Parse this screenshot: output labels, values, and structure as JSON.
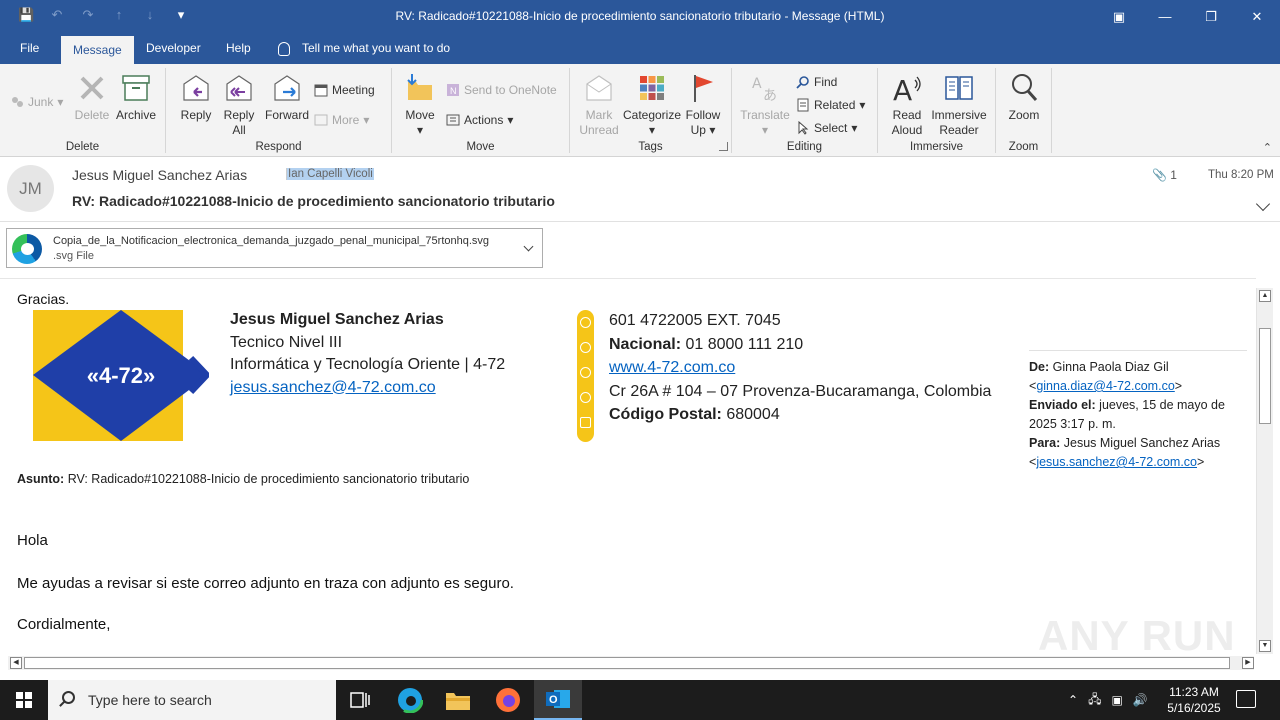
{
  "window": {
    "title": "RV: Radicado#10221088-Inicio de procedimiento sancionatorio tributario  -  Message (HTML)"
  },
  "ribbon": {
    "tabs": [
      {
        "label": "File",
        "active": false
      },
      {
        "label": "Message",
        "active": true
      },
      {
        "label": "Developer",
        "active": false
      },
      {
        "label": "Help",
        "active": false
      }
    ],
    "tell_me": "Tell me what you want to do",
    "groups": {
      "delete": {
        "label": "Delete",
        "junk": "Junk",
        "delete_btn": "Delete",
        "archive": "Archive"
      },
      "respond": {
        "label": "Respond",
        "reply": "Reply",
        "reply_all_1": "Reply",
        "reply_all_2": "All",
        "forward": "Forward",
        "meeting": "Meeting",
        "more": "More"
      },
      "move": {
        "label": "Move",
        "move_btn": "Move",
        "onenote": "Send to OneNote",
        "actions": "Actions"
      },
      "tags": {
        "label": "Tags",
        "mark_1": "Mark",
        "mark_2": "Unread",
        "categorize": "Categorize",
        "follow_1": "Follow",
        "follow_2": "Up"
      },
      "editing": {
        "label": "Editing",
        "translate": "Translate",
        "find": "Find",
        "related": "Related",
        "select": "Select"
      },
      "immersive": {
        "label": "Immersive",
        "read_1": "Read",
        "read_2": "Aloud",
        "immersive_1": "Immersive",
        "immersive_2": "Reader"
      },
      "zoom": {
        "label": "Zoom",
        "zoom_btn": "Zoom"
      }
    }
  },
  "message": {
    "avatar_initials": "JM",
    "sender": "Jesus Miguel Sanchez Arias",
    "recipient": "Ian Capelli Vicoli",
    "subject": "RV: Radicado#10221088-Inicio de procedimiento sancionatorio tributario",
    "attachment_count": "1",
    "time": "Thu 8:20 PM",
    "attachment": {
      "name": "Copia_de_la_Notificacion_electronica_demanda_juzgado_penal_municipal_75rtonhq.svg",
      "type": ".svg File"
    }
  },
  "body": {
    "thanks": "Gracias.",
    "logo_text": "«4-72»",
    "signature": {
      "name": "Jesus Miguel Sanchez Arias",
      "role": "Tecnico Nivel III",
      "dept": "Informática y Tecnología Oriente | 4-72",
      "email": "jesus.sanchez@4-72.com.co"
    },
    "contact": {
      "phone": "601 4722005 EXT. 7045",
      "national_label": "Nacional:",
      "national": " 01 8000 111 210",
      "web": "www.4-72.com.co",
      "address": "Cr 26A # 104 – 07 Provenza-Bucaramanga, Colombia",
      "postal_label": "Código Postal:",
      "postal": " 680004"
    },
    "forwarded": {
      "from_label": "De:",
      "from": " Ginna Paola Diaz Gil",
      "from_email": "ginna.diaz@4-72.com.co",
      "sent_label": "Enviado el:",
      "sent": " jueves, 15 de mayo de 2025 3:17 p. m.",
      "to_label": "Para:",
      "to": " Jesus Miguel Sanchez Arias",
      "to_email": "jesus.sanchez@4-72.com.co"
    },
    "asunto_label": "Asunto:",
    "asunto": " RV: Radicado#10221088-Inicio  de procedimiento sancionatorio tributario",
    "greeting": "Hola",
    "request": "Me ayudas a revisar si este correo adjunto en traza con adjunto es seguro.",
    "closing": "Cordialmente,",
    "watermark": "ANY  RUN"
  },
  "taskbar": {
    "search_placeholder": "Type here to search",
    "time": "11:23 AM",
    "date": "5/16/2025"
  },
  "colors": {
    "accent": "#2b579a",
    "brand_yellow": "#f5c518",
    "brand_blue": "#1f3fa8",
    "link": "#0563c1"
  }
}
